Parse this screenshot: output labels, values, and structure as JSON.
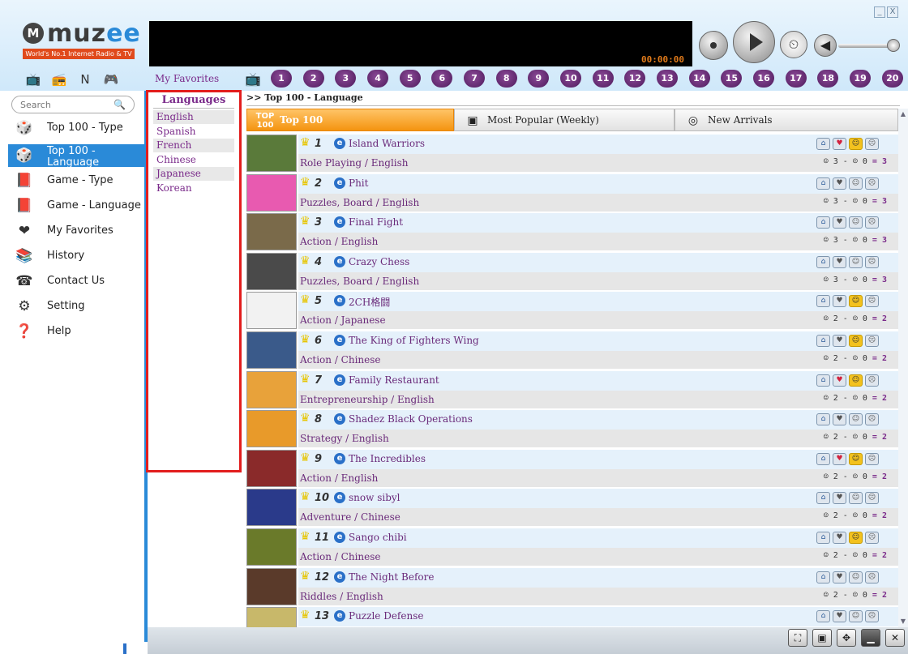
{
  "app": {
    "logo_text": "muzee",
    "logo_mark": "M",
    "tagline": "World's No.1 Internet Radio & TV",
    "timer": "00:00:00"
  },
  "window_buttons": [
    "_",
    "X"
  ],
  "player": {
    "stop_icon": "stop-circle-icon",
    "play_icon": "play-icon",
    "clock_glyph": "⏲",
    "volume_glyph": "◀",
    "volume_level": 0.85
  },
  "mode_icons": [
    {
      "name": "tv-mode-icon",
      "glyph": "📺"
    },
    {
      "name": "radio-mode-icon",
      "glyph": "📻"
    },
    {
      "name": "news-mode-icon",
      "glyph": "N"
    },
    {
      "name": "game-mode-icon",
      "glyph": "🎮"
    }
  ],
  "fav_label": "My Favorites",
  "tv_glyph": "📺",
  "numbers": [
    "1",
    "2",
    "3",
    "4",
    "5",
    "6",
    "7",
    "8",
    "9",
    "10",
    "11",
    "12",
    "13",
    "14",
    "15",
    "16",
    "17",
    "18",
    "19",
    "20"
  ],
  "search": {
    "placeholder": "Search",
    "icon": "🔍"
  },
  "nav": [
    {
      "label": "Top 100 - Type",
      "glyph": "🎲",
      "selected": false
    },
    {
      "label": "Top 100 - Language",
      "glyph": "🎲",
      "selected": true
    },
    {
      "label": "Game - Type",
      "glyph": "📕",
      "selected": false
    },
    {
      "label": "Game - Language",
      "glyph": "📕",
      "selected": false
    },
    {
      "label": "My Favorites",
      "glyph": "❤",
      "selected": false
    },
    {
      "label": "History",
      "glyph": "📚",
      "selected": false
    },
    {
      "label": "Contact Us",
      "glyph": "☎",
      "selected": false
    },
    {
      "label": "Setting",
      "glyph": "⚙",
      "selected": false
    },
    {
      "label": "Help",
      "glyph": "❓",
      "selected": false
    }
  ],
  "languages": {
    "title": "Languages",
    "items": [
      "English",
      "Spanish",
      "French",
      "Chinese",
      "Japanese",
      "Korean"
    ]
  },
  "breadcrumb": ">> Top 100 - Language",
  "tabs": [
    {
      "label": "Top 100",
      "icon_text": "TOP 100",
      "active": true
    },
    {
      "label": "Most Popular (Weekly)",
      "icon_text": "▣",
      "active": false
    },
    {
      "label": "New Arrivals",
      "icon_text": "◎",
      "active": false
    }
  ],
  "games": [
    {
      "rank": "1",
      "title": "Island Warriors",
      "genre": "Role Playing / English",
      "up": "3",
      "down": "0",
      "score": "3",
      "fav": true,
      "liked": true,
      "thumb": "#5a7a3a"
    },
    {
      "rank": "2",
      "title": "Phit",
      "genre": "Puzzles, Board / English",
      "up": "3",
      "down": "0",
      "score": "3",
      "fav": false,
      "liked": false,
      "thumb": "#e85ab0"
    },
    {
      "rank": "3",
      "title": "Final Fight",
      "genre": "Action / English",
      "up": "3",
      "down": "0",
      "score": "3",
      "fav": false,
      "liked": false,
      "thumb": "#7a6a4a"
    },
    {
      "rank": "4",
      "title": "Crazy Chess",
      "genre": "Puzzles, Board / English",
      "up": "3",
      "down": "0",
      "score": "3",
      "fav": false,
      "liked": false,
      "thumb": "#4a4a4a"
    },
    {
      "rank": "5",
      "title": "2CH格闘",
      "genre": "Action / Japanese",
      "up": "2",
      "down": "0",
      "score": "2",
      "fav": false,
      "liked": true,
      "thumb": "#f2f2f2"
    },
    {
      "rank": "6",
      "title": "The King of Fighters Wing",
      "genre": "Action / Chinese",
      "up": "2",
      "down": "0",
      "score": "2",
      "fav": false,
      "liked": true,
      "thumb": "#3a5a8a"
    },
    {
      "rank": "7",
      "title": "Family Restaurant",
      "genre": "Entrepreneurship / English",
      "up": "2",
      "down": "0",
      "score": "2",
      "fav": true,
      "liked": true,
      "thumb": "#e8a23a"
    },
    {
      "rank": "8",
      "title": "Shadez Black Operations",
      "genre": "Strategy / English",
      "up": "2",
      "down": "0",
      "score": "2",
      "fav": false,
      "liked": false,
      "thumb": "#e89a2a"
    },
    {
      "rank": "9",
      "title": "The Incredibles",
      "genre": "Action / English",
      "up": "2",
      "down": "0",
      "score": "2",
      "fav": true,
      "liked": true,
      "thumb": "#8a2a2a"
    },
    {
      "rank": "10",
      "title": "snow sibyl",
      "genre": "Adventure / Chinese",
      "up": "2",
      "down": "0",
      "score": "2",
      "fav": false,
      "liked": false,
      "thumb": "#2a3a8a"
    },
    {
      "rank": "11",
      "title": "Sango chibi",
      "genre": "Action / Chinese",
      "up": "2",
      "down": "0",
      "score": "2",
      "fav": false,
      "liked": true,
      "thumb": "#6a7a2a"
    },
    {
      "rank": "12",
      "title": "The Night Before",
      "genre": "Riddles / English",
      "up": "2",
      "down": "0",
      "score": "2",
      "fav": false,
      "liked": false,
      "thumb": "#5a3a2a"
    },
    {
      "rank": "13",
      "title": "Puzzle Defense",
      "genre": "",
      "up": "",
      "down": "",
      "score": "",
      "fav": false,
      "liked": false,
      "thumb": "#c8b86a"
    }
  ],
  "system_buttons": [
    {
      "name": "fullscreen-button",
      "glyph": "⛶",
      "dark": false
    },
    {
      "name": "window-mode-button",
      "glyph": "▣",
      "dark": false
    },
    {
      "name": "fit-button",
      "glyph": "✥",
      "dark": false
    },
    {
      "name": "minimize-button",
      "glyph": "▁",
      "dark": true
    },
    {
      "name": "close-button",
      "glyph": "✕",
      "dark": false
    }
  ],
  "colors": {
    "accent": "#2a8ad8",
    "tab_active": "#f49410",
    "highlight_border": "#e21d1d",
    "purple": "#7a2a8a"
  }
}
